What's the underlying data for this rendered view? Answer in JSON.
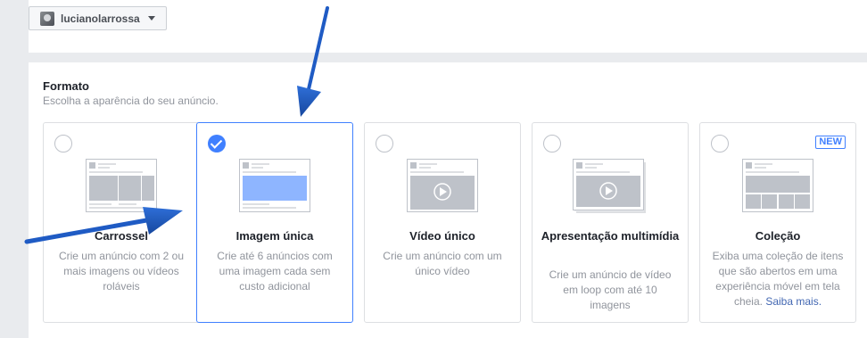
{
  "account": {
    "name": "lucianolarrossa"
  },
  "section": {
    "title": "Formato",
    "subtitle": "Escolha a aparência do seu anúncio."
  },
  "cards": [
    {
      "id": "carrossel",
      "title": "Carrossel",
      "description": "Crie um anúncio com 2 ou mais imagens ou vídeos roláveis",
      "selected": false
    },
    {
      "id": "imagem",
      "title": "Imagem única",
      "description": "Crie até 6 anúncios com uma imagem cada sem custo adicional",
      "selected": true
    },
    {
      "id": "video",
      "title": "Vídeo único",
      "description": "Crie um anúncio com um único vídeo",
      "selected": false
    },
    {
      "id": "apresentacao",
      "title": "Apresentação multimídia",
      "description": "Crie um anúncio de vídeo em loop com até 10 imagens",
      "selected": false
    },
    {
      "id": "colecao",
      "title": "Coleção",
      "description": "Exiba uma coleção de itens que são abertos em uma experiência móvel em tela cheia.",
      "link": "Saiba mais.",
      "badge": "NEW",
      "selected": false
    }
  ],
  "colors": {
    "accent": "#4080ff",
    "arrow": "#1f5bc4",
    "link": "#4267b2"
  }
}
